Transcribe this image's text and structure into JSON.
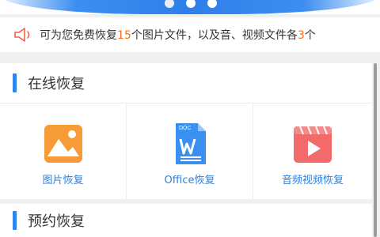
{
  "notice": {
    "seg1": "可为您免费恢复",
    "count_images": "15",
    "seg2": "个图片文件，以及音、视频文件各",
    "count_av": "3",
    "seg3": "个"
  },
  "online": {
    "title": "在线恢复",
    "tiles": [
      {
        "label": "图片恢复",
        "icon": "image-icon"
      },
      {
        "label": "Office恢复",
        "icon": "word-document-icon",
        "badge": "DOC"
      },
      {
        "label": "音频视频恢复",
        "icon": "video-play-icon"
      }
    ]
  },
  "reserve": {
    "title": "预约恢复"
  },
  "colors": {
    "accent": "#2e86ec",
    "highlight": "#ff6a1a",
    "image_icon": "#f79a38",
    "doc_icon": "#3b8ff0",
    "video_icon": "#f36a6a"
  }
}
